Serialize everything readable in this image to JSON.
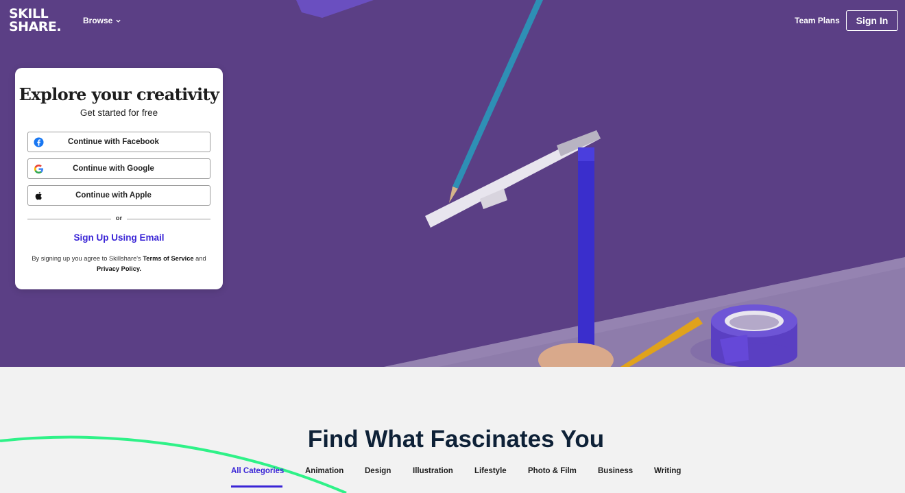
{
  "brand": {
    "logo_line1": "SKILL",
    "logo_line2": "SHARE.",
    "accent_color": "#3a25d6",
    "hero_bg_color": "#5b3f85"
  },
  "nav": {
    "browse_label": "Browse",
    "team_plans_label": "Team Plans",
    "sign_in_label": "Sign In"
  },
  "signup_card": {
    "title": "Explore your creativity",
    "subtitle": "Get started for free",
    "buttons": [
      {
        "label": "Continue with Facebook",
        "icon": "facebook-icon"
      },
      {
        "label": "Continue with Google",
        "icon": "google-icon"
      },
      {
        "label": "Continue with Apple",
        "icon": "apple-icon"
      }
    ],
    "divider_text": "or",
    "email_signup_label": "Sign Up Using Email",
    "terms_prefix": "By signing up you agree to Skillshare's",
    "terms_link": "Terms of Service",
    "terms_middle": "and",
    "privacy_link": "Privacy Policy."
  },
  "categories": {
    "heading": "Find What Fascinates You",
    "tabs": [
      {
        "label": "All Categories",
        "active": true
      },
      {
        "label": "Animation",
        "active": false
      },
      {
        "label": "Design",
        "active": false
      },
      {
        "label": "Illustration",
        "active": false
      },
      {
        "label": "Lifestyle",
        "active": false
      },
      {
        "label": "Photo & Film",
        "active": false
      },
      {
        "label": "Business",
        "active": false
      },
      {
        "label": "Writing",
        "active": false
      }
    ]
  }
}
